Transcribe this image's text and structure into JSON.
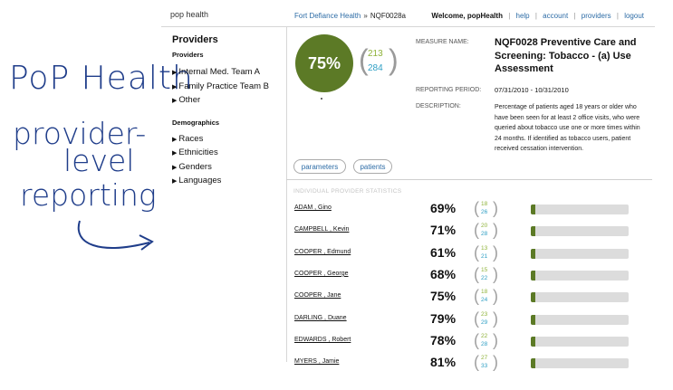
{
  "annotation": {
    "line1": "PoP Health",
    "line2": "provider-",
    "line3": "level",
    "line4": "reporting"
  },
  "header": {
    "logo": "pop health",
    "breadcrumb": [
      "Fort Defiance Health",
      "NQF0028a"
    ],
    "breadcrumb_sep": "»",
    "welcome": "Welcome, popHealth",
    "links": [
      "help",
      "account",
      "providers",
      "logout"
    ]
  },
  "sidebar": {
    "title": "Providers",
    "providers_heading": "Providers",
    "providers": [
      "Internal Med. Team A",
      "Family Practice Team B",
      "Other"
    ],
    "demographics_heading": "Demographics",
    "demographics": [
      "Races",
      "Ethnicities",
      "Genders",
      "Languages"
    ]
  },
  "measure": {
    "score": "75%",
    "numerator": "213",
    "denominator": "284",
    "name_label": "MEASURE NAME:",
    "name": "NQF0028 Preventive Care and Screening: Tobacco - (a) Use Assessment",
    "period_label": "REPORTING PERIOD:",
    "period": "07/31/2010 - 10/31/2010",
    "desc_label": "DESCRIPTION:",
    "description": "Percentage of patients aged 18 years or older who have been seen for at least 2 office visits, who were queried about tobacco use one or more times within 24 months. If identified as tobacco users, patient received cessation intervention."
  },
  "buttons": {
    "parameters": "parameters",
    "patients": "patients"
  },
  "stats": {
    "title": "INDIVIDUAL PROVIDER STATISTICS",
    "providers": [
      {
        "name": "ADAM , Gino",
        "pct": "69%",
        "num": "18",
        "den": "26",
        "fill": 0.05
      },
      {
        "name": "CAMPBELL , Kevin",
        "pct": "71%",
        "num": "20",
        "den": "28",
        "fill": 0.05
      },
      {
        "name": "COOPER , Edmund",
        "pct": "61%",
        "num": "13",
        "den": "21",
        "fill": 0.05
      },
      {
        "name": "COOPER , George",
        "pct": "68%",
        "num": "15",
        "den": "22",
        "fill": 0.05
      },
      {
        "name": "COOPER , Jane",
        "pct": "75%",
        "num": "18",
        "den": "24",
        "fill": 0.05
      },
      {
        "name": "DARLING , Duane",
        "pct": "79%",
        "num": "23",
        "den": "29",
        "fill": 0.05
      },
      {
        "name": "EDWARDS , Robert",
        "pct": "78%",
        "num": "22",
        "den": "28",
        "fill": 0.05
      },
      {
        "name": "MYERS , Jamie",
        "pct": "81%",
        "num": "27",
        "den": "33",
        "fill": 0.05
      }
    ]
  }
}
